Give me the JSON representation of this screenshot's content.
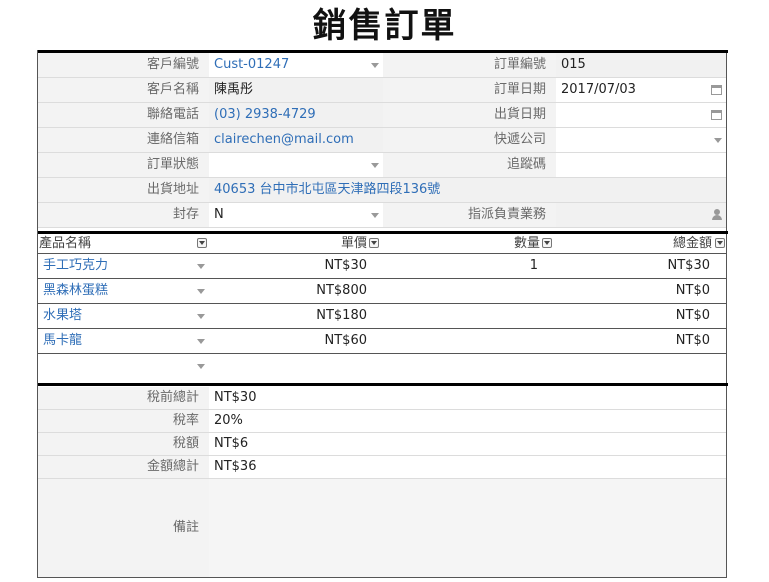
{
  "title": "銷售訂單",
  "order_fields": {
    "customer_id_label": "客戶編號",
    "customer_id": "Cust-01247",
    "order_no_label": "訂單編號",
    "order_no": "015",
    "customer_name_label": "客戶名稱",
    "customer_name": "陳禹彤",
    "order_date_label": "訂單日期",
    "order_date": "2017/07/03",
    "phone_label": "聯絡電話",
    "phone": "(03) 2938-4729",
    "ship_date_label": "出貨日期",
    "ship_date": "",
    "email_label": "連絡信箱",
    "email": "clairechen@mail.com",
    "courier_label": "快遞公司",
    "courier": "",
    "status_label": "訂單狀態",
    "status": "",
    "tracking_label": "追蹤碼",
    "tracking": "",
    "address_label": "出貨地址",
    "address": "40653 台中市北屯區天津路四段136號",
    "archive_label": "封存",
    "archive": "N",
    "sales_rep_label": "指派負責業務",
    "sales_rep": ""
  },
  "products": {
    "headers": [
      "產品名稱",
      "單價",
      "數量",
      "總金額"
    ],
    "rows": [
      {
        "name": "手工巧克力",
        "price": "NT$30",
        "qty": "1",
        "total": "NT$30"
      },
      {
        "name": "黑森林蛋糕",
        "price": "NT$800",
        "qty": "",
        "total": "NT$0"
      },
      {
        "name": "水果塔",
        "price": "NT$180",
        "qty": "",
        "total": "NT$0"
      },
      {
        "name": "馬卡龍",
        "price": "NT$60",
        "qty": "",
        "total": "NT$0"
      },
      {
        "name": "",
        "price": "",
        "qty": "",
        "total": ""
      }
    ]
  },
  "summary": {
    "subtotal_label": "稅前總計",
    "subtotal": "NT$30",
    "tax_rate_label": "稅率",
    "tax_rate": "20%",
    "tax_label": "稅額",
    "tax": "NT$6",
    "grand_total_label": "金額總計",
    "grand_total": "NT$36",
    "notes_label": "備註",
    "notes": ""
  },
  "colors": {
    "link": "#2f6eb7",
    "label_bg": "#f3f3f3",
    "border_dark": "#000000"
  },
  "icons": {
    "dropdown": "chevron-down-icon",
    "date": "calendar-icon",
    "assignee": "person-icon",
    "column_menu": "column-menu-icon"
  }
}
